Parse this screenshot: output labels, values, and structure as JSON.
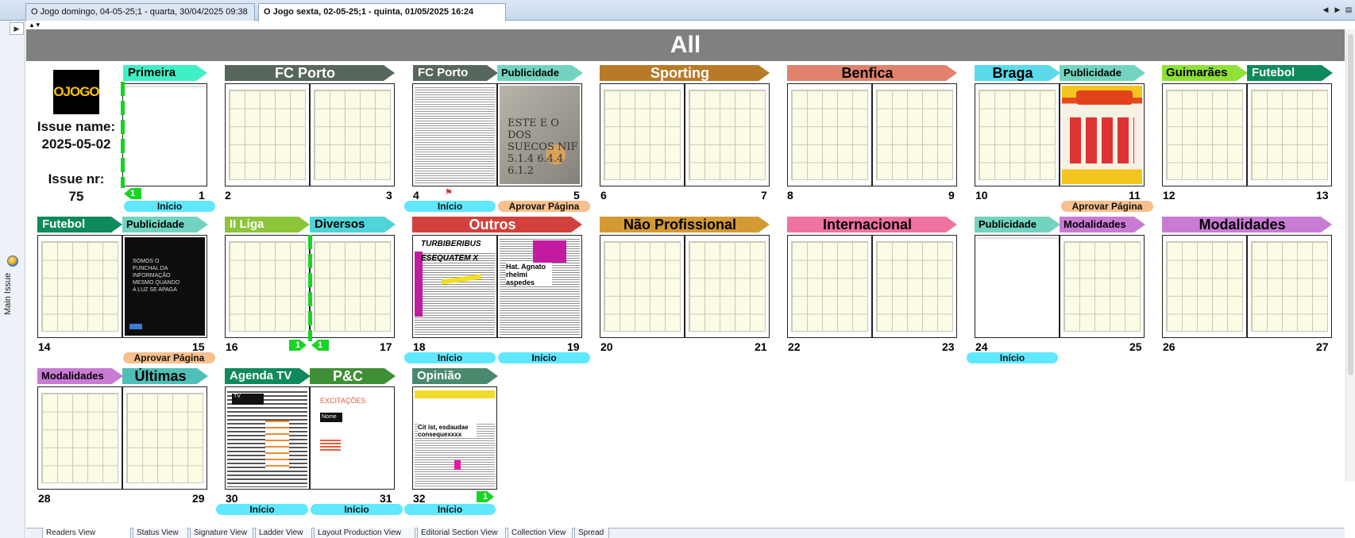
{
  "document_tabs": [
    {
      "label": "O Jogo  domingo, 04-05-25;1 - quarta, 30/04/2025 09:38"
    },
    {
      "label": "O Jogo  sexta, 02-05-25;1 - quinta, 01/05/2025 16:24"
    }
  ],
  "sidebar": {
    "label": "Main Issue"
  },
  "header": {
    "title": "All"
  },
  "issue": {
    "logo_text": "OJOGO",
    "name_label": "Issue name:",
    "name_value": "2025-05-02",
    "nr_label": "Issue nr:",
    "nr_value": "75"
  },
  "sections": {
    "primeira": "Primeira",
    "fcporto_a": "FC Porto",
    "fcporto_b": "FC Porto",
    "pub_5": "Publicidade",
    "sporting": "Sporting",
    "benfica": "Benfica",
    "braga": "Braga",
    "pub_11": "Publicidade",
    "guimaraes": "Guimarães",
    "futebol_13": "Futebol",
    "futebol_14": "Futebol",
    "pub_15": "Publicidade",
    "iiliga": "II Liga",
    "diversos": "Diversos",
    "outros": "Outros",
    "naoprof": "Não Profissional",
    "internacional": "Internacional",
    "pub_24": "Publicidade",
    "mod_25": "Modalidades",
    "mod_26": "Modalidades",
    "mod_28": "Modalidades",
    "ultimas": "Últimas",
    "agendatv": "Agenda TV",
    "pc": "P&C",
    "opiniao": "Opinião"
  },
  "pages": [
    "1",
    "2",
    "3",
    "4",
    "5",
    "6",
    "7",
    "8",
    "9",
    "10",
    "11",
    "12",
    "13",
    "14",
    "15",
    "16",
    "17",
    "18",
    "19",
    "20",
    "21",
    "22",
    "23",
    "24",
    "25",
    "26",
    "27",
    "28",
    "29",
    "30",
    "31",
    "32"
  ],
  "status": {
    "inicio": "Início",
    "aprovar": "Aprovar Página"
  },
  "lock_count": "1",
  "thumbs": {
    "p5": "ESTE E O DOS SUECOS NIF 5.1.4 6.4.4 6.1.2",
    "p15": "SOMOS O FUNCHAL DA INFORMAÇÃO MESMO QUANDO A LUZ SE APAGA",
    "p18": "TURBIBERIBUS ESEQUATEM X",
    "p19": "Hat. Agnato rhelmi aspedes",
    "p30": "TV",
    "p31a": "EXCITAÇÕES",
    "p31b": "Nome da semana",
    "p32": "Cit ist, esdaudae consequexxxx"
  },
  "bottom_tabs": [
    "Readers View",
    "Status View",
    "Signature View",
    "Ladder View",
    "Layout Production View",
    "Editorial Section View",
    "Collection View",
    "Spread"
  ],
  "colors": {
    "header_bg": "#808080",
    "inicio": "#5fe8ff",
    "aprovar": "#f7c08c",
    "lock": "#18d625"
  }
}
